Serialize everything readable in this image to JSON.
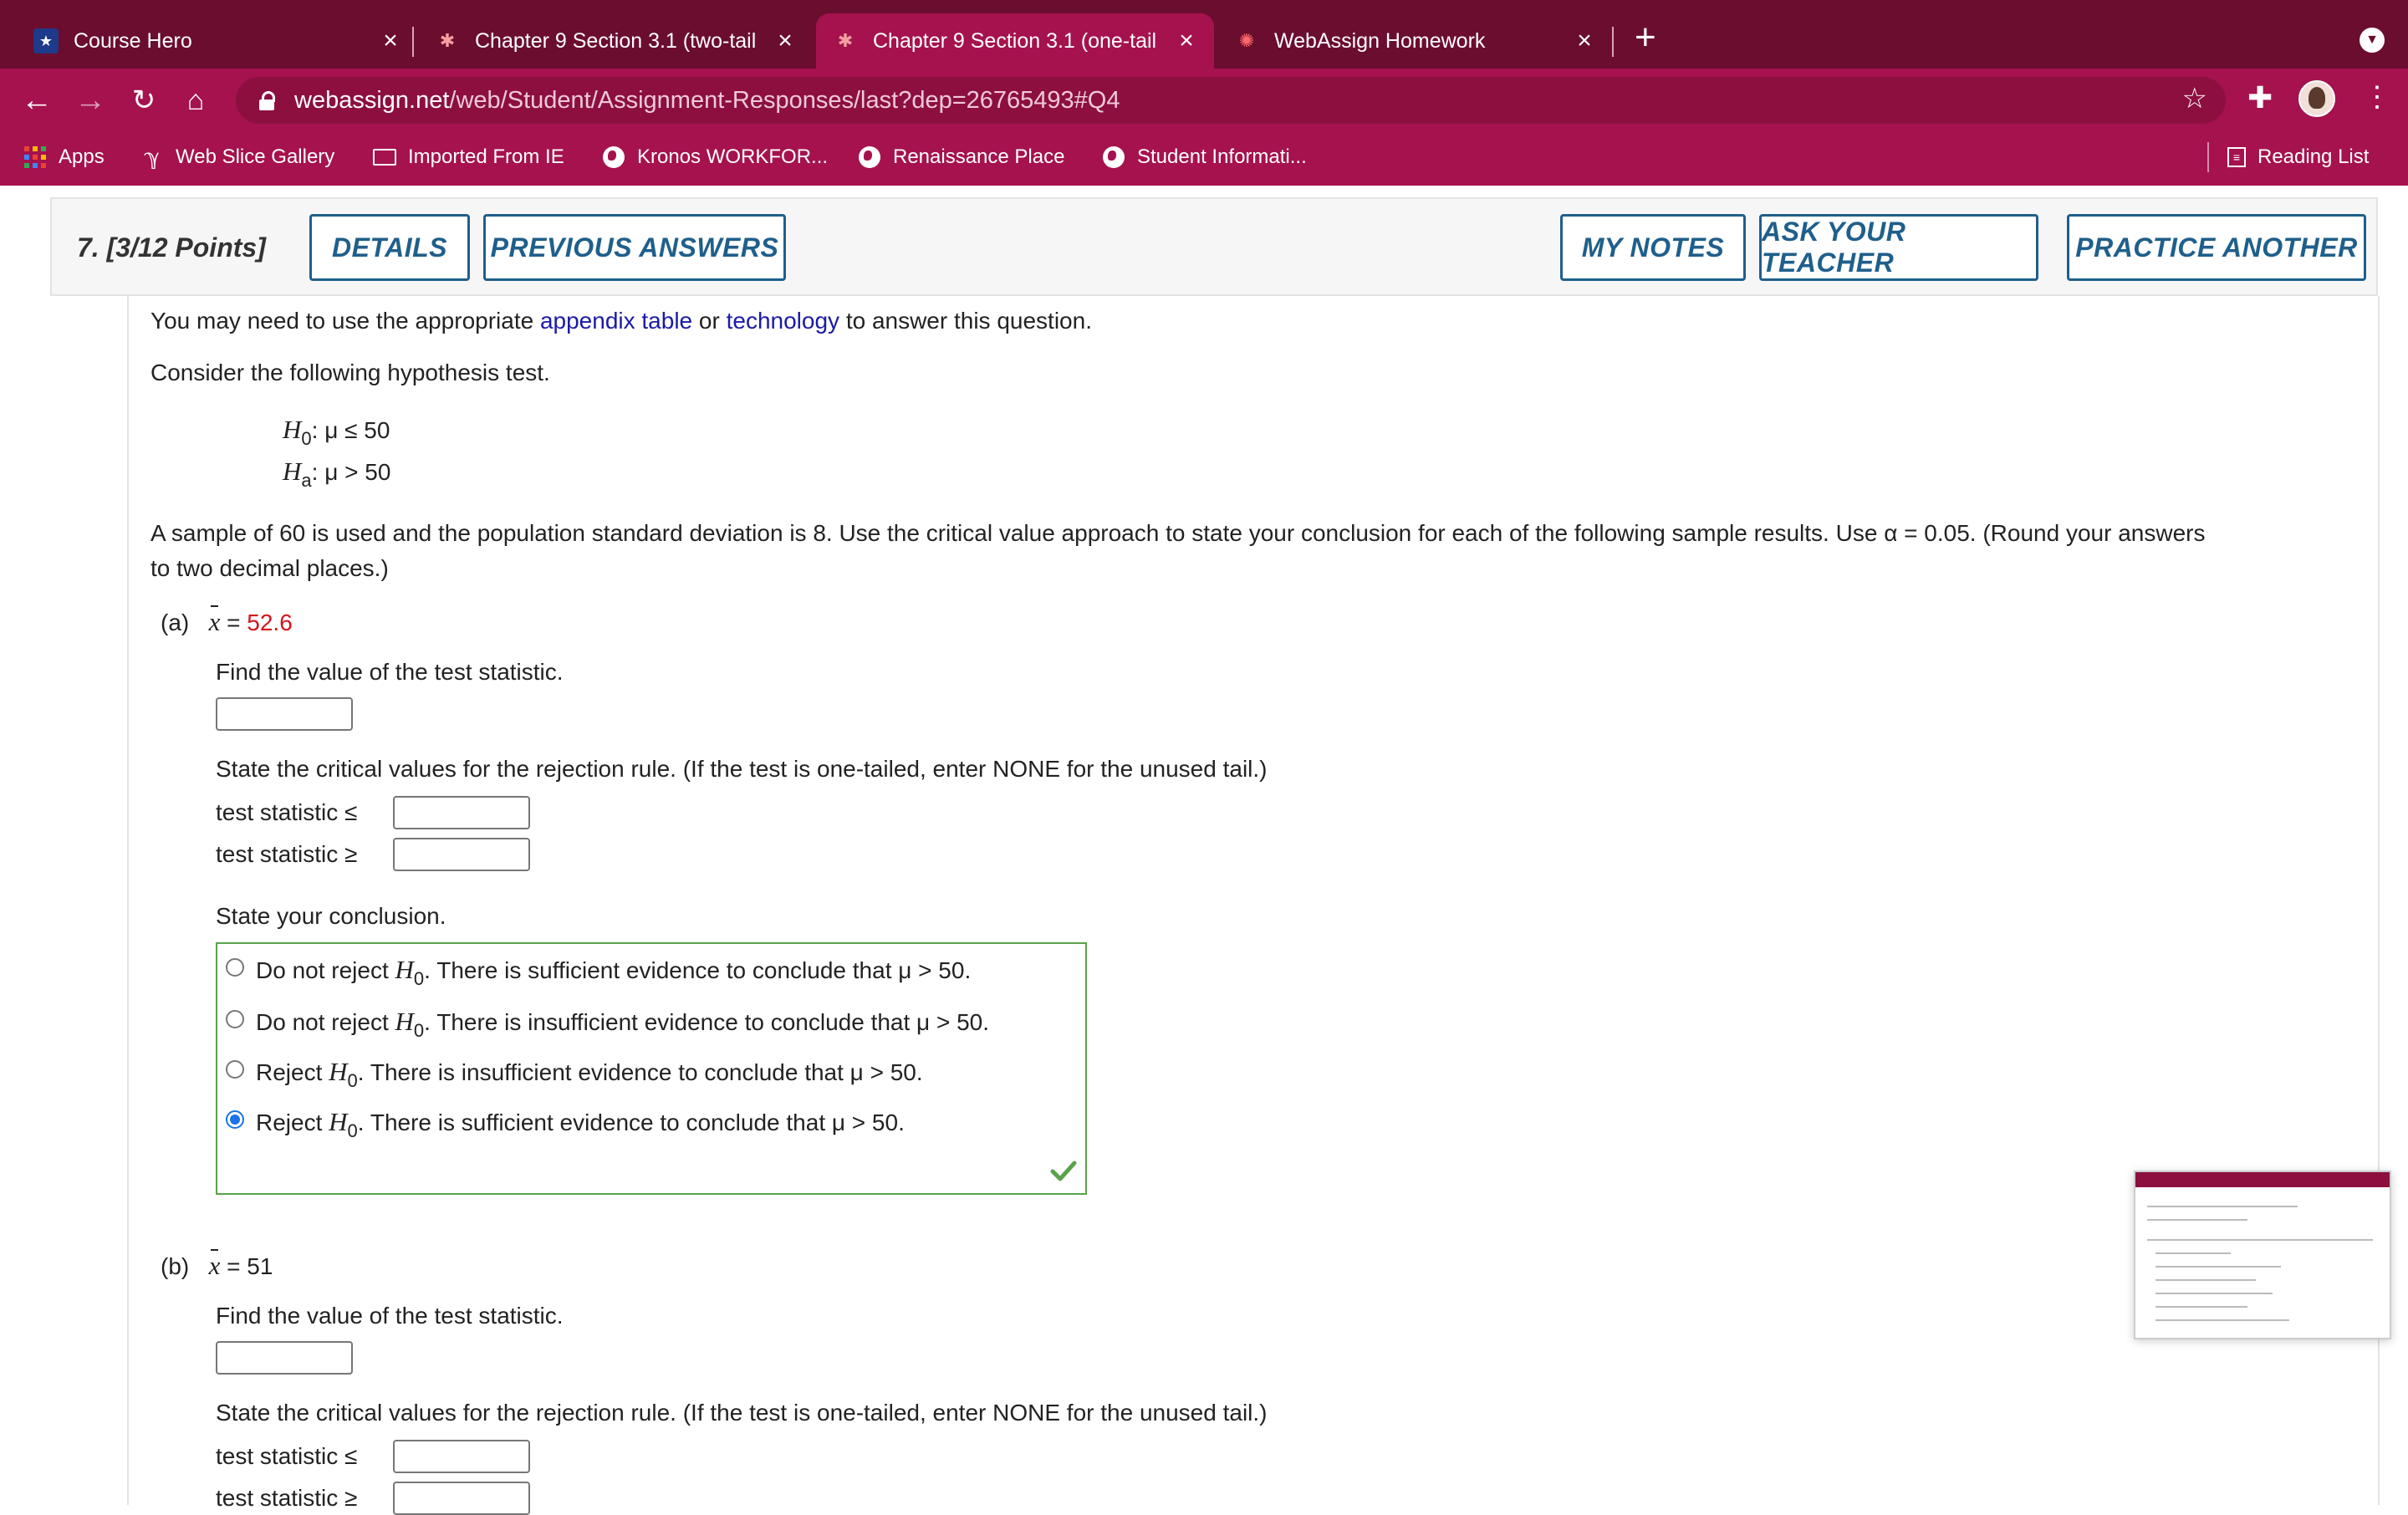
{
  "browser": {
    "tabs": [
      {
        "title": "Course Hero",
        "icon": "star-icon",
        "active": false
      },
      {
        "title": "Chapter 9 Section 3.1 (two-tail",
        "icon": "webassign-icon",
        "active": false
      },
      {
        "title": "Chapter 9 Section 3.1 (one-tail",
        "icon": "webassign-icon",
        "active": true
      },
      {
        "title": "WebAssign Homework",
        "icon": "webassign-icon",
        "active": false
      }
    ],
    "url_domain": "webassign.net",
    "url_path": "/web/Student/Assignment-Responses/last?dep=26765493#Q4",
    "bookmarks": [
      "Apps",
      "Web Slice Gallery",
      "Imported From IE",
      "Kronos WORKFOR...",
      "Renaissance Place",
      "Student Informati..."
    ],
    "reading_list": "Reading List",
    "accent": "#a5124e"
  },
  "question": {
    "number": "7.",
    "points": "[3/12 Points]",
    "buttons": {
      "details": "DETAILS",
      "previous": "PREVIOUS ANSWERS",
      "notes": "MY NOTES",
      "ask": "ASK YOUR TEACHER",
      "practice": "PRACTICE ANOTHER"
    },
    "intro_1": "You may need to use the appropriate",
    "appendix_link": "appendix table",
    "intro_or": "or",
    "technology_link": "technology",
    "intro_2": "to answer this question.",
    "consider": "Consider the following hypothesis test.",
    "h0": ": μ ≤ 50",
    "ha": ": μ > 50",
    "h0_letter": "H",
    "h0_sub": "0",
    "ha_letter": "H",
    "ha_sub": "a",
    "prompt_line1": "A sample of 60 is used and the population standard deviation is 8. Use the critical value approach to state your conclusion for each of the following sample results. Use α = 0.05. (Round your answers",
    "prompt_line2": "to two decimal places.)",
    "parts": [
      {
        "label": "(a)",
        "xbar_value": "52.6",
        "find_stat": "Find the value of the test statistic.",
        "critical_text": "State the critical values for the rejection rule. (If the test is one-tailed, enter NONE for the unused tail.)",
        "ts_le": "test statistic  ≤",
        "ts_ge": "test statistic  ≥",
        "conclusion_label": "State your conclusion.",
        "options": [
          {
            "pre": "Do not reject ",
            "post": ". There is sufficient evidence to conclude that μ > 50.",
            "selected": false
          },
          {
            "pre": "Do not reject ",
            "post": ". There is insufficient evidence to conclude that μ > 50.",
            "selected": false
          },
          {
            "pre": "Reject ",
            "post": ". There is insufficient evidence to conclude that μ > 50.",
            "selected": false
          },
          {
            "pre": "Reject ",
            "post": ". There is sufficient evidence to conclude that μ > 50.",
            "selected": true
          }
        ]
      },
      {
        "label": "(b)",
        "xbar_value": "51",
        "find_stat": "Find the value of the test statistic.",
        "critical_text": "State the critical values for the rejection rule. (If the test is one-tailed, enter NONE for the unused tail.)",
        "ts_le": "test statistic  ≤",
        "ts_ge": "test statistic  ≥"
      }
    ],
    "xbar_symbol": "x",
    "equals": "=",
    "h_letter": "H",
    "h_sub": "0"
  }
}
